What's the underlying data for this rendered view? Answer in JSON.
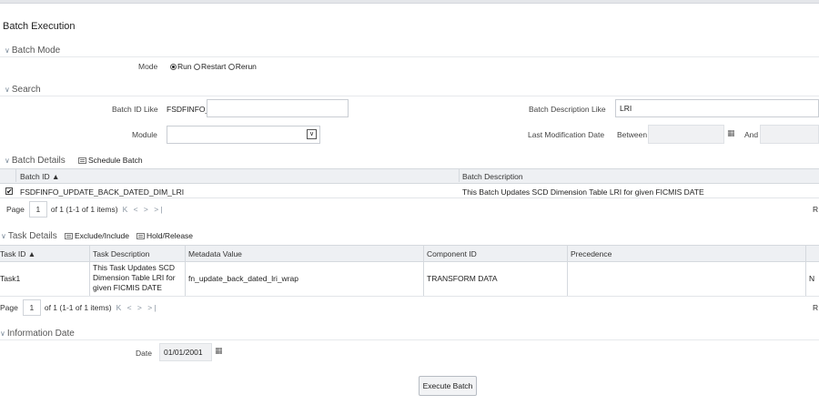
{
  "page_title": "Batch Execution",
  "batch_mode": {
    "heading": "Batch Mode",
    "mode_label": "Mode",
    "options": [
      "Run",
      "Restart",
      "Rerun"
    ],
    "selected": "Run"
  },
  "search": {
    "heading": "Search",
    "batch_id_label": "Batch ID Like",
    "batch_id_prefix": "FSDFINFO_",
    "batch_id_value": "",
    "batch_desc_label": "Batch Description Like",
    "batch_desc_value": "LRI",
    "module_label": "Module",
    "module_value": "",
    "last_mod_label": "Last Modification Date",
    "between_label": "Between",
    "and_label": "And"
  },
  "batch_details": {
    "heading": "Batch Details",
    "schedule_label": "Schedule Batch",
    "columns": [
      "Batch ID ▲",
      "Batch Description"
    ],
    "rows": [
      {
        "id": "FSDFINFO_UPDATE_BACK_DATED_DIM_LRI",
        "description": "This Batch Updates SCD Dimension Table LRI for given FICMIS DATE",
        "checked": "✔"
      }
    ],
    "pager": {
      "page_label": "Page",
      "page": "1",
      "summary": "of 1 (1-1 of 1 items)",
      "nav": "K < > >|",
      "right_text": "R"
    }
  },
  "task_details": {
    "heading": "Task Details",
    "exclude_label": "Exclude/Include",
    "hold_label": "Hold/Release",
    "columns": [
      "Task ID ▲",
      "Task Description",
      "Metadata Value",
      "Component ID",
      "Precedence"
    ],
    "rows": [
      {
        "task_id": "Task1",
        "description": "This Task Updates SCD Dimension Table LRI for given FICMIS DATE",
        "metadata": "fn_update_back_dated_lri_wrap",
        "component": "TRANSFORM DATA",
        "precedence": "",
        "extra": "N"
      }
    ],
    "pager": {
      "page_label": "Page",
      "page": "1",
      "summary": "of 1 (1-1 of 1 items)",
      "nav": "K < > >|",
      "right_text": "R"
    }
  },
  "information_date": {
    "heading": "Information Date",
    "date_label": "Date",
    "date_value": "01/01/2001"
  },
  "execute_button": "Execute Batch",
  "icons": {
    "chevron": "∨",
    "calendar": "▦"
  }
}
